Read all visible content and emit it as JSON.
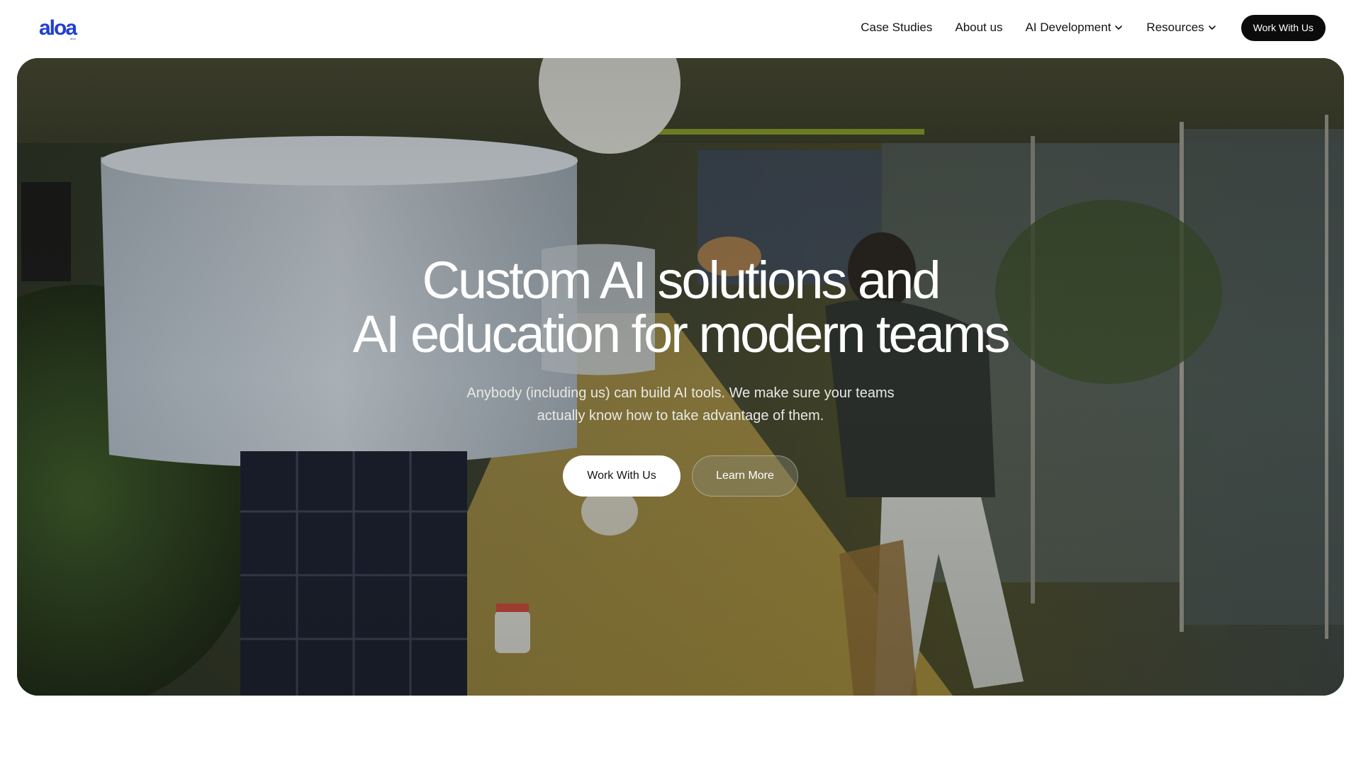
{
  "brand": {
    "logo_text": "aloa",
    "logo_subtext": "aloa",
    "logo_color": "#1f3fd4"
  },
  "nav": {
    "items": [
      {
        "label": "Case Studies",
        "has_dropdown": false
      },
      {
        "label": "About us",
        "has_dropdown": false
      },
      {
        "label": "AI Development",
        "has_dropdown": true
      },
      {
        "label": "Resources",
        "has_dropdown": true
      }
    ],
    "cta_label": "Work With Us"
  },
  "hero": {
    "title_line1": "Custom AI solutions and",
    "title_line2": "AI education for modern teams",
    "subtitle_line1": "Anybody (including us) can build AI tools. We make sure your teams",
    "subtitle_line2": "actually know how to take advantage of them.",
    "primary_button": "Work With Us",
    "secondary_button": "Learn More",
    "background": "office-video-still"
  },
  "colors": {
    "nav_cta_bg": "#0b0b0b",
    "primary_button_bg": "#ffffff",
    "text_dark": "#141414"
  }
}
